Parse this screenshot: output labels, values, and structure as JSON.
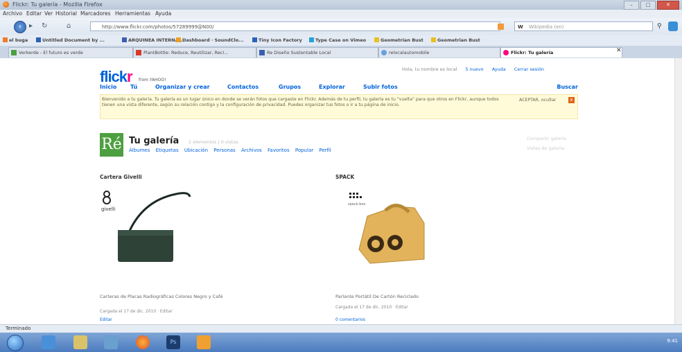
{
  "window": {
    "title": "Flickr: Tu galería - Mozilla Firefox"
  },
  "menubar": [
    "Archivo",
    "Editar",
    "Ver",
    "Historial",
    "Marcadores",
    "Herramientas",
    "Ayuda"
  ],
  "navbar": {
    "url": "http://www.flickr.com/photos/57289999@N00/",
    "search_engine": "W",
    "search_placeholder": "Wikipedia (en)"
  },
  "bookmarks": [
    {
      "label": "el buga",
      "color": "#f07a2a"
    },
    {
      "label": "Untitled Document by ...",
      "color": "#2a62b8"
    },
    {
      "label": "ARQUINEA INTERNA...",
      "color": "#3a5fb0"
    },
    {
      "label": "Dashboard · SoundClo...",
      "color": "#f0a020"
    },
    {
      "label": "Tiny Icon Factory",
      "color": "#2a62b8"
    },
    {
      "label": "Type Case on Vimeo",
      "color": "#2aa0d8"
    },
    {
      "label": "Geometrian Bust",
      "color": "#e8c020"
    },
    {
      "label": "Geometrian Bust",
      "color": "#e8c020"
    }
  ],
  "tabs": [
    {
      "label": "Verkerde - El futuro es verde",
      "color": "#4aa040",
      "active": false
    },
    {
      "label": "PlantBottle: Reduce, Reutilizar, Reci...",
      "color": "#d83a2a",
      "active": false
    },
    {
      "label": "Re Diseño Sustentable Local",
      "color": "#3a5fb0",
      "active": false
    },
    {
      "label": "relocalautomobile",
      "color": "#6aa0e0",
      "active": false
    },
    {
      "label": "Flickr: Tu galería",
      "color": "#ff0084",
      "active": true
    }
  ],
  "flickr": {
    "logo_main": "flick",
    "logo_r": "r",
    "logo_sub": "from YAHOO!",
    "toplinks": {
      "greeting": "Hola, tu nombre es local",
      "mail": "5 nuevo",
      "help": "Ayuda",
      "signout": "Cerrar sesión"
    },
    "nav": {
      "home": "Inicio",
      "you": "Tú",
      "organize": "Organizar y crear",
      "contacts": "Contactos",
      "groups": "Grupos",
      "explore": "Explorar",
      "upload": "Subir fotos",
      "search": "Buscar"
    },
    "banner": {
      "message": "Bienvenido a tu galería. Tu galería es un lugar único en donde se verán fotos que cargaste en Flickr. Además de tu perfil, tu galería es tu \"vuelta\" para que otros en Flickr, aunque todos tienen una vista diferente, según su relación contigo y la configuración de privacidad. Puedes organizar tus fotos o ir a tu página de inicio.",
      "accept": "ACEPTAR, ocultar",
      "close": "x"
    },
    "gallery": {
      "avatar_text": "Ré",
      "title": "Tu galería",
      "count": "2 elementos | 0 vistas",
      "subnav": [
        "Álbumes",
        "Etiquetas",
        "Ubicación",
        "Personas",
        "Archivos",
        "Favoritos",
        "Popular",
        "Perfil"
      ],
      "meta1": "Compartir galería",
      "meta2": "Vistas de galería"
    },
    "items": [
      {
        "title": "Cartera Givelli",
        "description": "Carteras de Placas Radiográficas Colores Negro y Café",
        "meta": "Cargada el 17 de dic. 2010 · Editar",
        "extra": "Editar"
      },
      {
        "title": "SPACK",
        "description": "Parlante Portátil De Cartón Reciclado",
        "meta": "Cargada el 17 de dic. 2010 · Editar",
        "extra": "0 comentarios"
      }
    ]
  },
  "status": "Terminado",
  "taskbar": {
    "clock": "9:41"
  }
}
